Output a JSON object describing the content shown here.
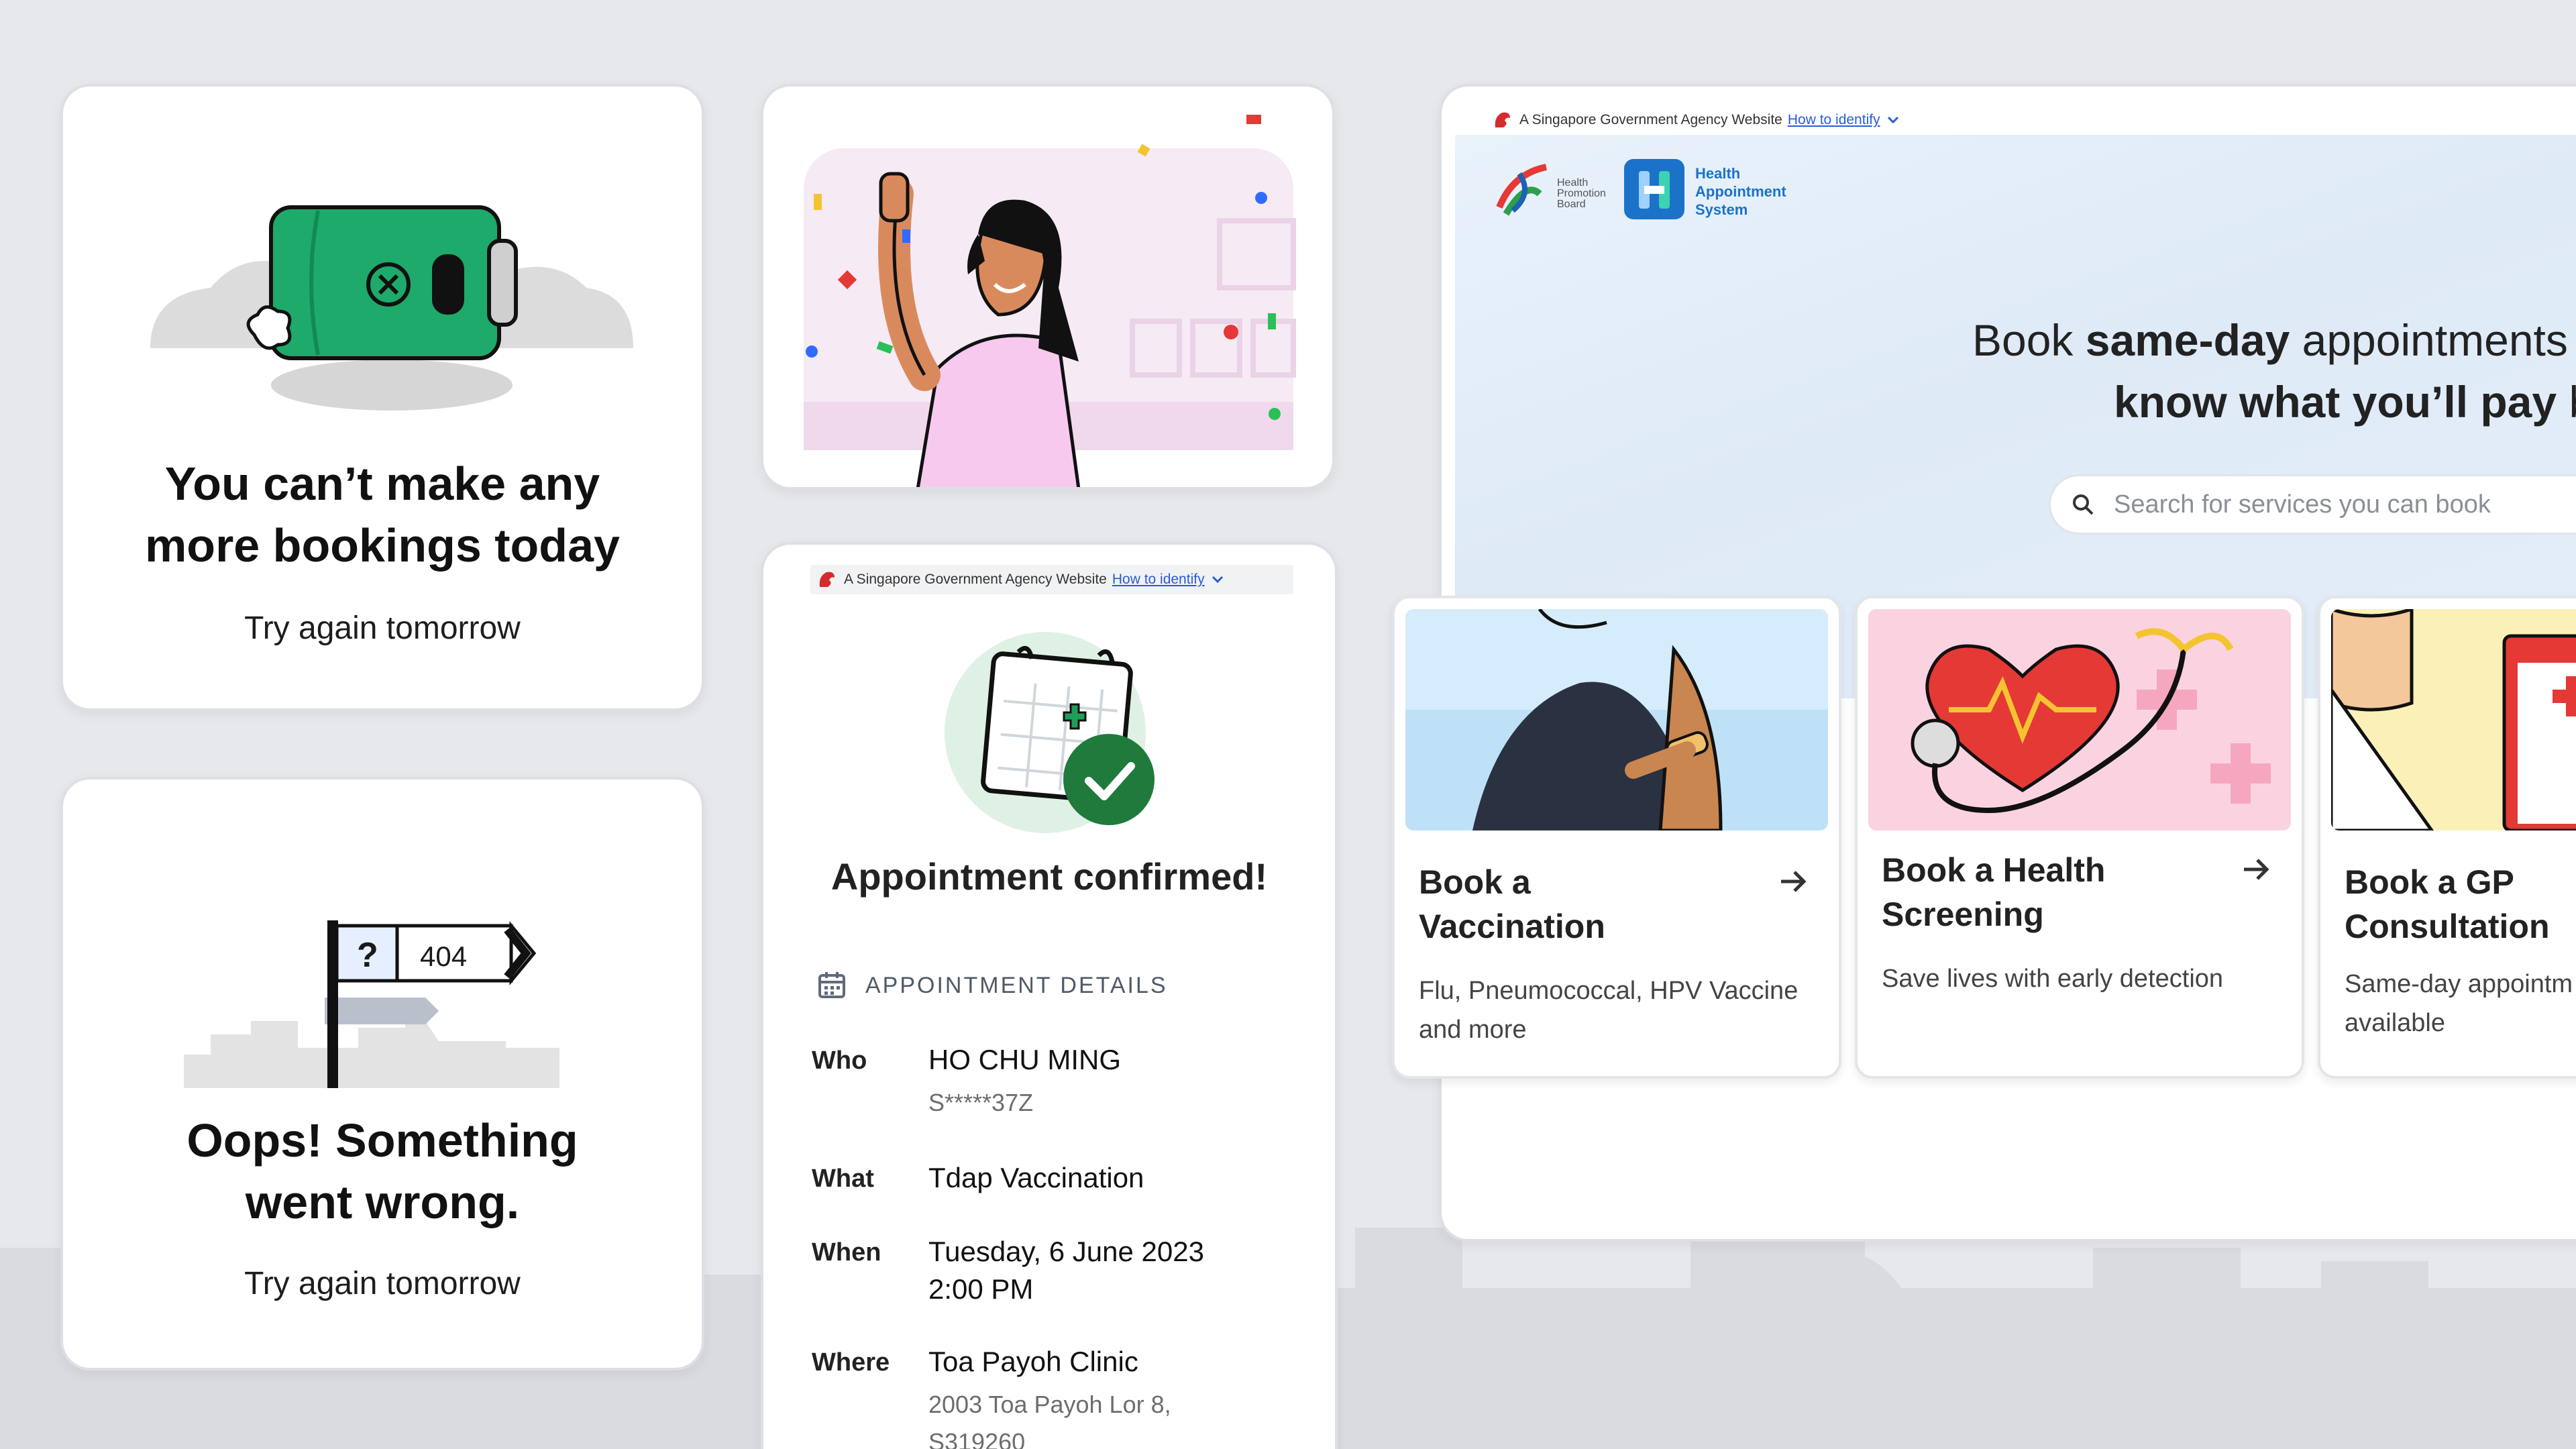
{
  "limit_card": {
    "title_line1": "You can’t make any",
    "title_line2": "more bookings today",
    "subtitle": "Try again tomorrow"
  },
  "error_card": {
    "sign_question": "?",
    "sign_code": "404",
    "title_line1": "Oops! Something",
    "title_line2": "went wrong.",
    "subtitle": "Try again tomorrow"
  },
  "masthead": {
    "text": "A Singapore Government Agency Website",
    "link": "How to identify"
  },
  "confirmation": {
    "title": "Appointment confirmed!",
    "section_header": "APPOINTMENT DETAILS",
    "details": {
      "who_label": "Who",
      "who_name": "HO CHU MING",
      "who_id": "S*****37Z",
      "what_label": "What",
      "what_value": "Tdap Vaccination",
      "when_label": "When",
      "when_date": "Tuesday, 6 June 2023",
      "when_time": "2:00 PM",
      "where_label": "Where",
      "where_clinic": "Toa Payoh Clinic",
      "where_address1": "2003 Toa Payoh Lor 8,",
      "where_address2": "S319260"
    }
  },
  "site": {
    "hpb_logo_text": [
      "Health",
      "Promotion",
      "Board"
    ],
    "has_logo_text": [
      "Health",
      "Appointment",
      "System"
    ],
    "hero": {
      "line1_pre": "Book ",
      "line1_bold": "same-day",
      "line1_post": " appointments",
      "line2_bold": "know what you’ll pay",
      "line2_post": " be"
    },
    "search_placeholder": "Search for services you can book",
    "services": [
      {
        "title_line1": "Book a",
        "title_line2": "Vaccination",
        "desc_line1": "Flu, Pneumococcal, HPV Vaccine",
        "desc_line2": "and more"
      },
      {
        "title_line1": "Book a Health",
        "title_line2": "Screening",
        "desc_line1": "Save lives with early detection",
        "desc_line2": ""
      },
      {
        "title_line1": "Book a GP",
        "title_line2": "Consultation",
        "desc_line1": "Same-day appointm",
        "desc_line2": "available"
      }
    ]
  },
  "colors": {
    "battery_green": "#1eaa6a",
    "confirm_green": "#1f7a3c",
    "link_blue": "#2a5bd7",
    "has_blue": "#1a73c9",
    "heart_red": "#e53935"
  }
}
